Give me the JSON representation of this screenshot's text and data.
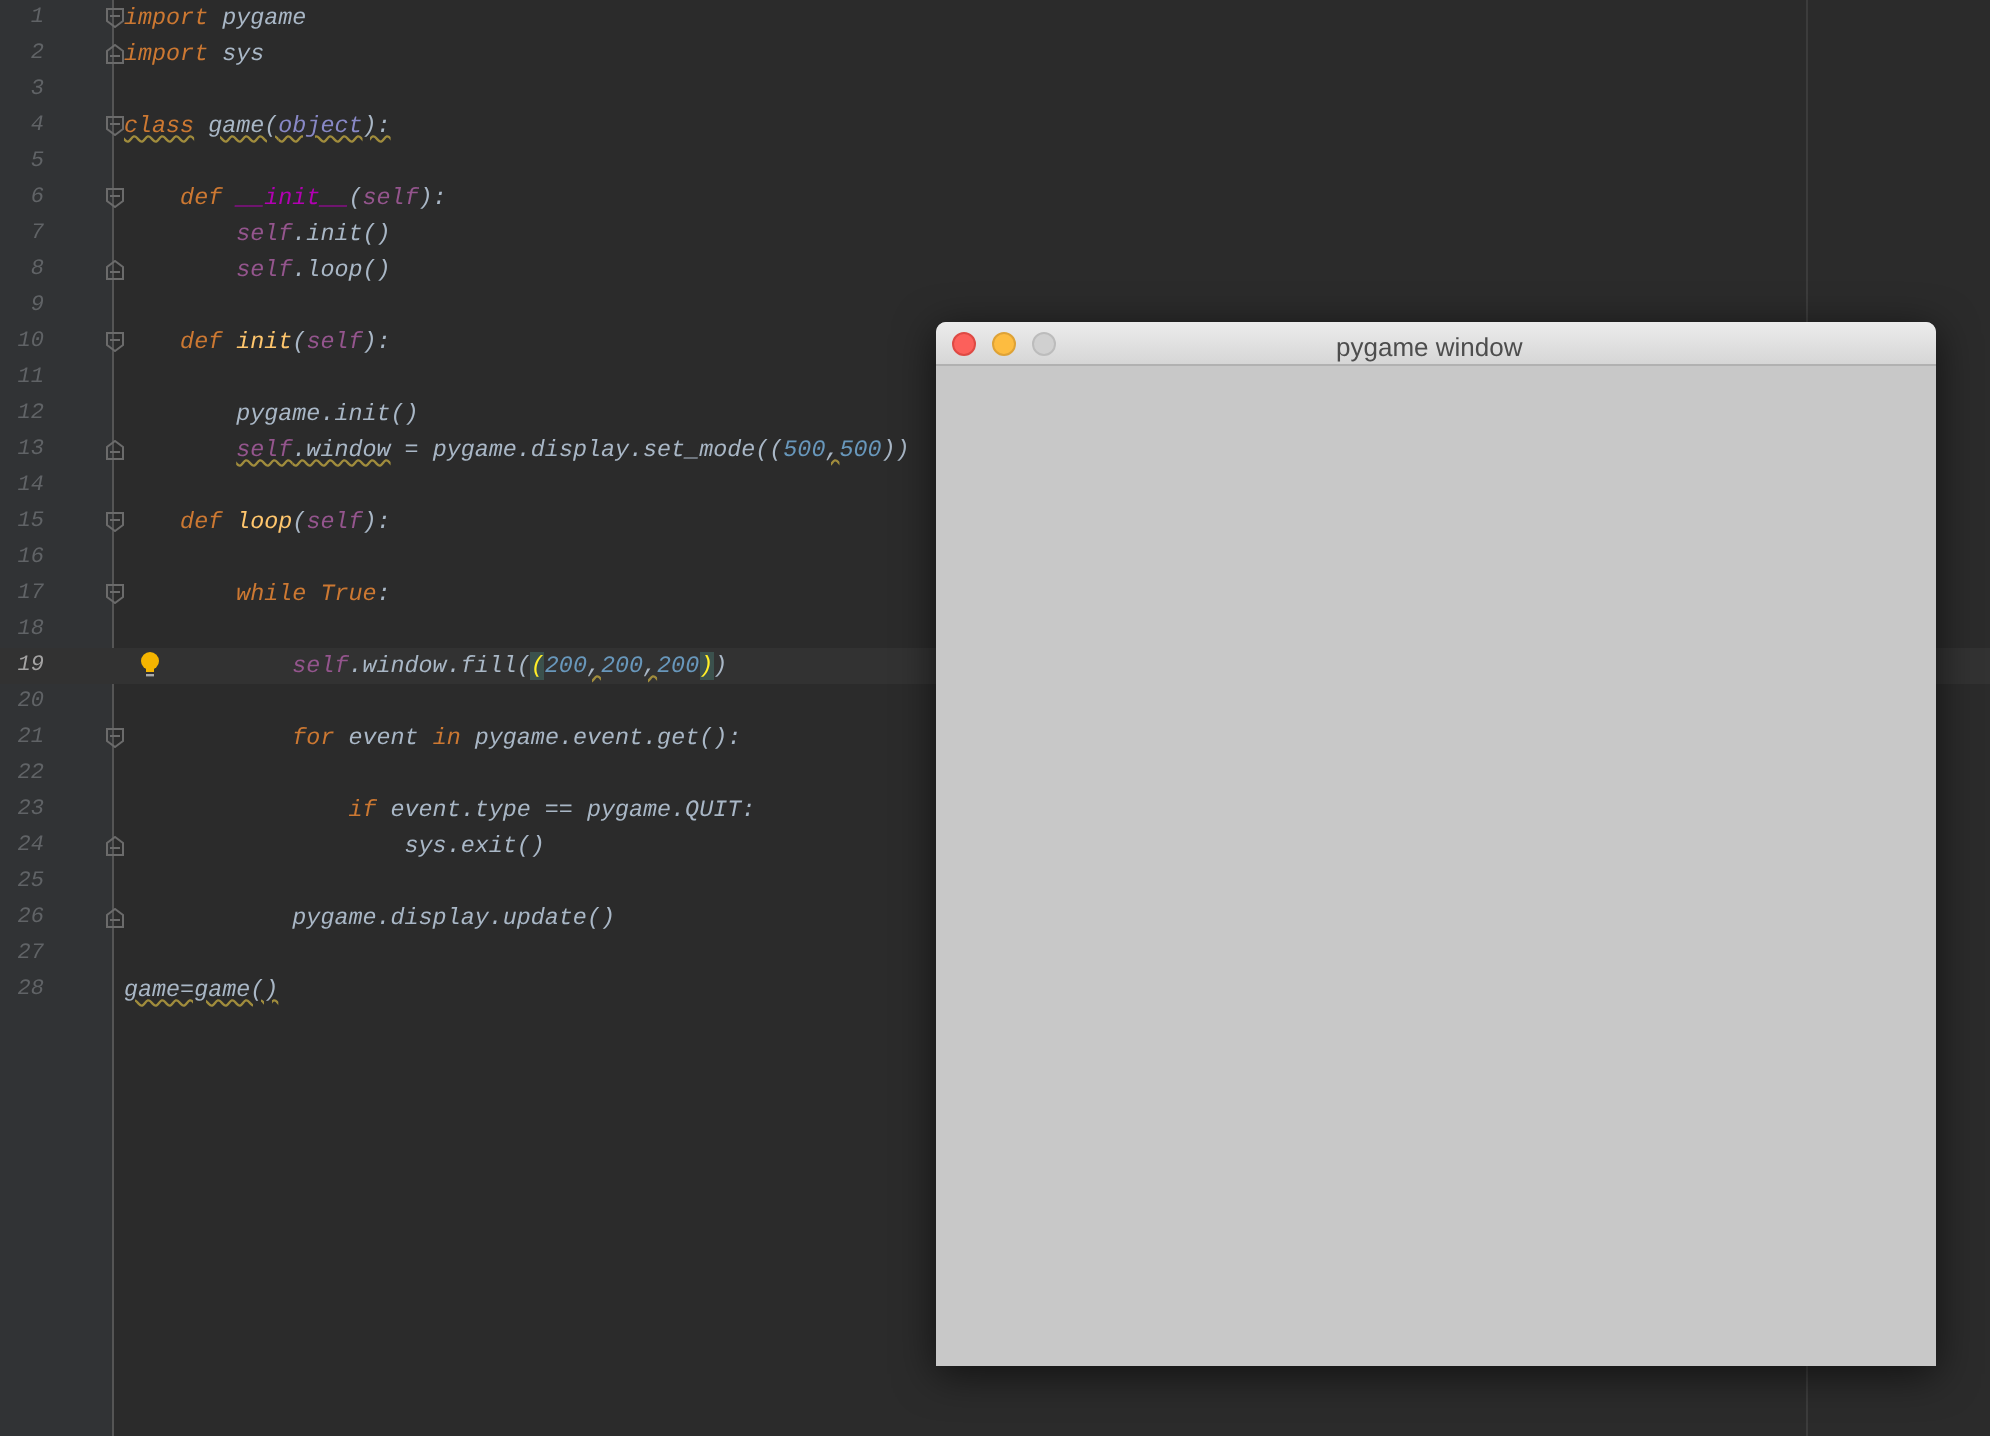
{
  "editor": {
    "lines": [
      {
        "number": "1",
        "current": false,
        "fold_start": true,
        "tokens": [
          {
            "kind": "kw",
            "text": "import"
          },
          {
            "kind": "plain",
            "text": " pygame"
          }
        ]
      },
      {
        "number": "2",
        "current": false,
        "fold_end": true,
        "tokens": [
          {
            "kind": "kw",
            "text": "import"
          },
          {
            "kind": "plain",
            "text": " sys"
          }
        ]
      },
      {
        "number": "3",
        "current": false
      },
      {
        "number": "4",
        "current": false,
        "fold_start": true,
        "tokens": [
          {
            "kind": "kw",
            "text": "class",
            "warn": true
          },
          {
            "kind": "plain",
            "text": " game(",
            "warn": true
          },
          {
            "kind": "builtin",
            "text": "object",
            "warn": true
          },
          {
            "kind": "plain",
            "text": "):",
            "warn": true
          }
        ]
      },
      {
        "number": "5",
        "current": false
      },
      {
        "number": "6",
        "current": false,
        "fold_start": true,
        "tokens": [
          {
            "kind": "kw",
            "text": "    def "
          },
          {
            "kind": "magic",
            "text": "__init__"
          },
          {
            "kind": "plain",
            "text": "("
          },
          {
            "kind": "self",
            "text": "self"
          },
          {
            "kind": "plain",
            "text": "):"
          }
        ]
      },
      {
        "number": "7",
        "current": false,
        "tokens": [
          {
            "kind": "self",
            "text": "        self"
          },
          {
            "kind": "plain",
            "text": ".init()"
          }
        ]
      },
      {
        "number": "8",
        "current": false,
        "fold_end": true,
        "tokens": [
          {
            "kind": "self",
            "text": "        self"
          },
          {
            "kind": "plain",
            "text": ".loop()"
          }
        ]
      },
      {
        "number": "9",
        "current": false
      },
      {
        "number": "10",
        "current": false,
        "fold_start": true,
        "tokens": [
          {
            "kind": "kw",
            "text": "    def "
          },
          {
            "kind": "fn",
            "text": "init"
          },
          {
            "kind": "plain",
            "text": "("
          },
          {
            "kind": "self",
            "text": "self"
          },
          {
            "kind": "plain",
            "text": "):"
          }
        ]
      },
      {
        "number": "11",
        "current": false
      },
      {
        "number": "12",
        "current": false,
        "tokens": [
          {
            "kind": "plain",
            "text": "        pygame.init()"
          }
        ]
      },
      {
        "number": "13",
        "current": false,
        "fold_end": true,
        "tokens": [
          {
            "kind": "self",
            "text": "        self",
            "warn": true
          },
          {
            "kind": "plain",
            "text": ".window",
            "warn": true
          },
          {
            "kind": "plain",
            "text": " = pygame.display.set_mode(("
          },
          {
            "kind": "num",
            "text": "500"
          },
          {
            "kind": "plain",
            "text": ",",
            "warn": true
          },
          {
            "kind": "num",
            "text": "500"
          },
          {
            "kind": "plain",
            "text": "))"
          }
        ]
      },
      {
        "number": "14",
        "current": false
      },
      {
        "number": "15",
        "current": false,
        "fold_start": true,
        "tokens": [
          {
            "kind": "kw",
            "text": "    def "
          },
          {
            "kind": "fn",
            "text": "loop"
          },
          {
            "kind": "plain",
            "text": "("
          },
          {
            "kind": "self",
            "text": "self"
          },
          {
            "kind": "plain",
            "text": "):"
          }
        ]
      },
      {
        "number": "16",
        "current": false
      },
      {
        "number": "17",
        "current": false,
        "fold_start": true,
        "tokens": [
          {
            "kind": "kw",
            "text": "        while True"
          },
          {
            "kind": "plain",
            "text": ":"
          }
        ]
      },
      {
        "number": "18",
        "current": false
      },
      {
        "number": "19",
        "current": true,
        "bulb": true,
        "tokens": [
          {
            "kind": "self",
            "text": "            self"
          },
          {
            "kind": "plain",
            "text": ".window.fill("
          },
          {
            "kind": "match",
            "text": "("
          },
          {
            "kind": "num",
            "text": "200"
          },
          {
            "kind": "plain",
            "text": ",",
            "warn": true
          },
          {
            "kind": "num",
            "text": "200"
          },
          {
            "kind": "plain",
            "text": ",",
            "warn": true
          },
          {
            "kind": "num",
            "text": "200"
          },
          {
            "kind": "match",
            "text": ")"
          },
          {
            "kind": "plain",
            "text": ")"
          }
        ]
      },
      {
        "number": "20",
        "current": false
      },
      {
        "number": "21",
        "current": false,
        "fold_start": true,
        "tokens": [
          {
            "kind": "kw",
            "text": "            for"
          },
          {
            "kind": "plain",
            "text": " event "
          },
          {
            "kind": "kw",
            "text": "in"
          },
          {
            "kind": "plain",
            "text": " pygame.event.get():"
          }
        ]
      },
      {
        "number": "22",
        "current": false
      },
      {
        "number": "23",
        "current": false,
        "tokens": [
          {
            "kind": "kw",
            "text": "                if"
          },
          {
            "kind": "plain",
            "text": " event.type == pygame.QUIT:"
          }
        ]
      },
      {
        "number": "24",
        "current": false,
        "fold_end": true,
        "tokens": [
          {
            "kind": "plain",
            "text": "                    sys.exit()"
          }
        ]
      },
      {
        "number": "25",
        "current": false
      },
      {
        "number": "26",
        "current": false,
        "fold_end": true,
        "tokens": [
          {
            "kind": "plain",
            "text": "            pygame.display.update()"
          }
        ]
      },
      {
        "number": "27",
        "current": false
      },
      {
        "number": "28",
        "current": false,
        "tokens": [
          {
            "kind": "plain",
            "text": "game=game()",
            "warn": true
          }
        ]
      }
    ]
  },
  "window": {
    "title": "pygame window"
  }
}
